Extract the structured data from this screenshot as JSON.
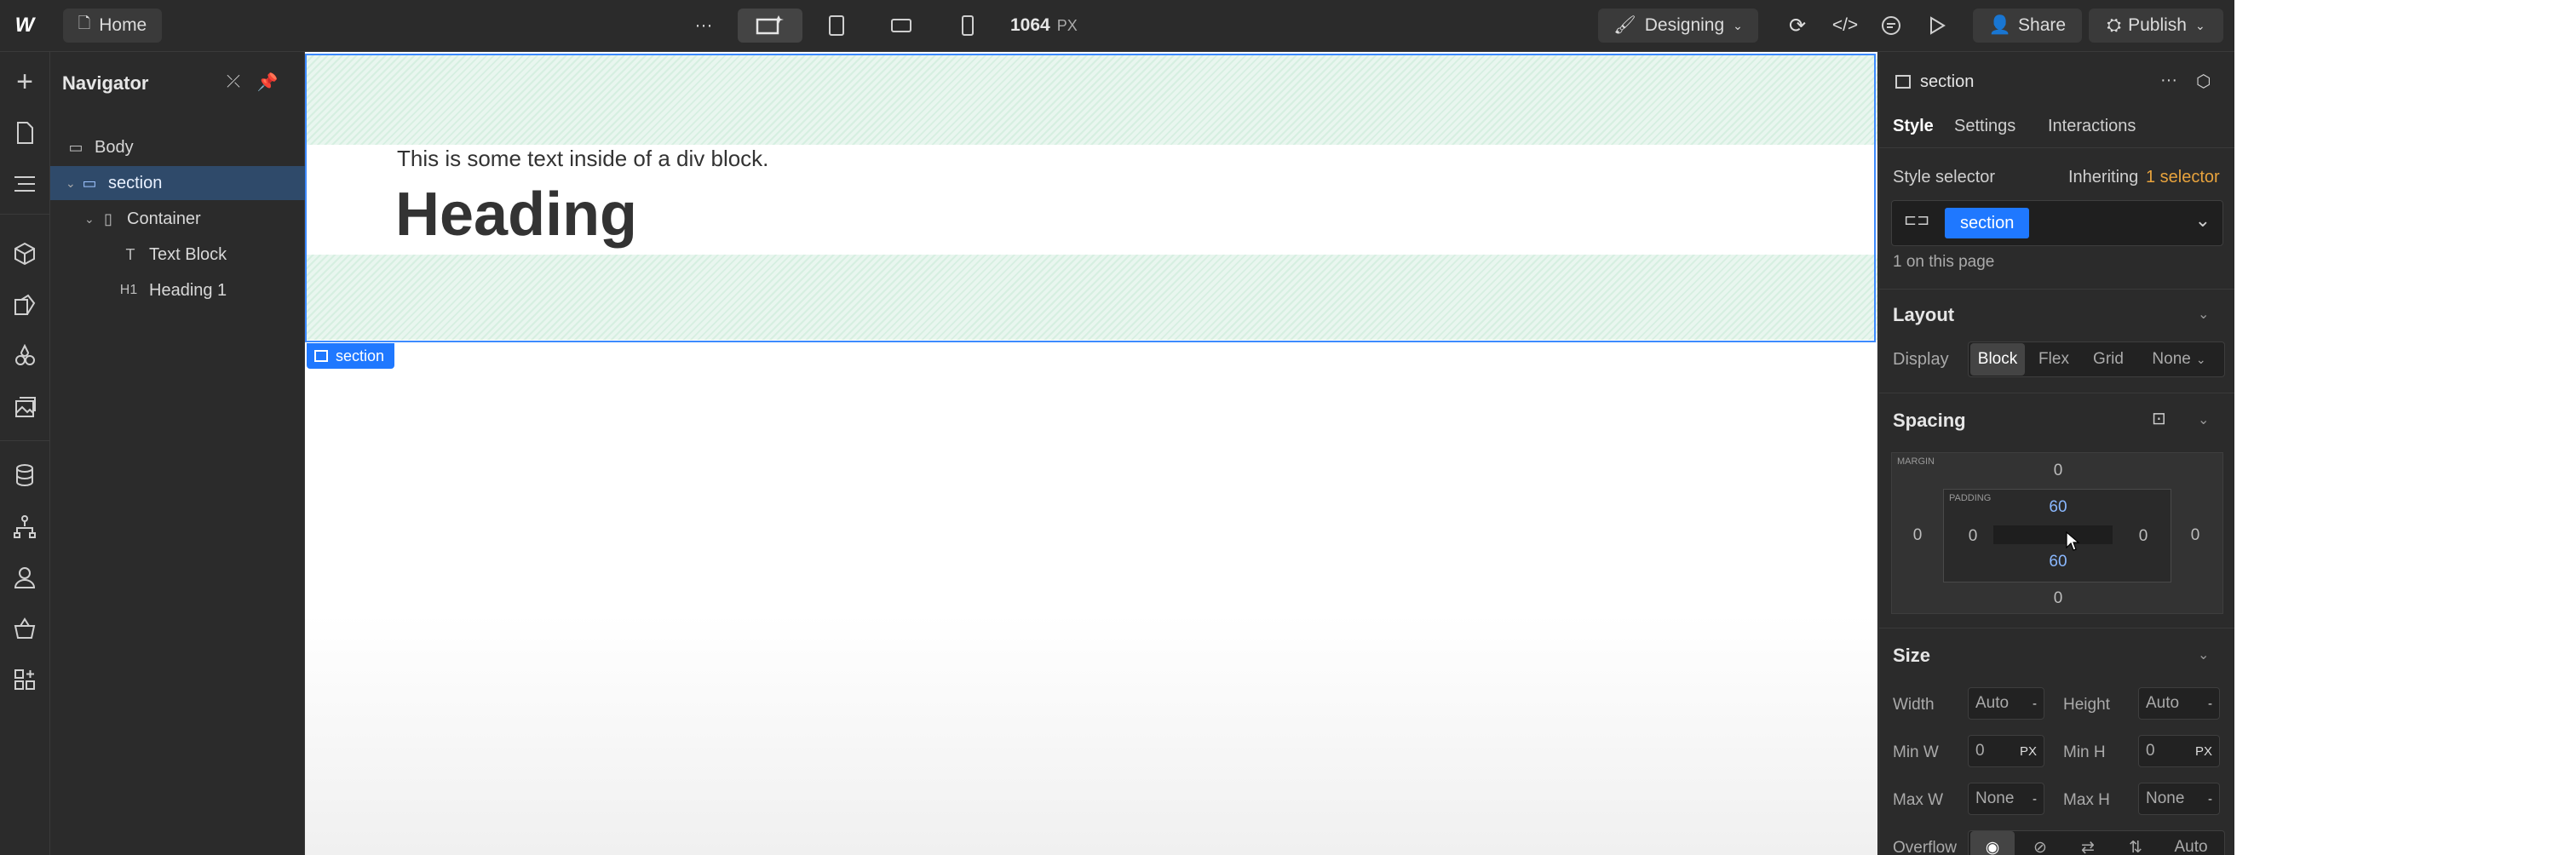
{
  "topbar": {
    "logo": "W",
    "home_label": "Home",
    "more": "···",
    "width_value": "1064",
    "width_unit": "PX",
    "mode_label": "Designing",
    "share_label": "Share",
    "publish_label": "Publish"
  },
  "rail": {
    "items": [
      "add-icon",
      "pages-icon",
      "navigator-icon",
      "components-icon",
      "variables-icon",
      "style-icon",
      "assets-icon",
      "cms-icon",
      "logic-icon",
      "users-icon",
      "ecommerce-icon",
      "apps-icon"
    ]
  },
  "navigator": {
    "title": "Navigator",
    "items": [
      {
        "label": "Body",
        "icon": "body-icon"
      },
      {
        "label": "section",
        "icon": "section-icon"
      },
      {
        "label": "Container",
        "icon": "container-icon"
      },
      {
        "label": "Text Block",
        "icon": "T"
      },
      {
        "label": "Heading 1",
        "icon": "H1"
      }
    ]
  },
  "canvas": {
    "text": "This is some text inside of a div block.",
    "heading": "Heading",
    "section_tag": "section"
  },
  "panel": {
    "element_name": "section",
    "tabs": [
      "Style",
      "Settings",
      "Interactions"
    ],
    "style_selector_label": "Style selector",
    "inheriting_label": "Inheriting",
    "inheriting_count": "1 selector",
    "selector_chip": "section",
    "on_page": "1 on this page",
    "layout": {
      "title": "Layout",
      "display_label": "Display",
      "options": [
        "Block",
        "Flex",
        "Grid",
        "None"
      ],
      "selected": "Block"
    },
    "spacing": {
      "title": "Spacing",
      "margin_label": "MARGIN",
      "padding_label": "PADDING",
      "margin": {
        "top": "0",
        "right": "0",
        "bottom": "0",
        "left": "0"
      },
      "padding": {
        "top": "60",
        "right": "0",
        "bottom": "60",
        "left": "0"
      }
    },
    "size": {
      "title": "Size",
      "width_label": "Width",
      "width_value": "Auto",
      "height_label": "Height",
      "height_value": "Auto",
      "minw_label": "Min W",
      "minw_value": "0",
      "minw_unit": "PX",
      "minh_label": "Min H",
      "minh_value": "0",
      "minh_unit": "PX",
      "maxw_label": "Max W",
      "maxw_value": "None",
      "maxh_label": "Max H",
      "maxh_value": "None",
      "overflow_label": "Overflow",
      "overflow_auto": "Auto"
    }
  },
  "colors": {
    "accent": "#1f78ff",
    "inherit": "#e8a33d",
    "panel_bg": "#2b2b2b"
  }
}
